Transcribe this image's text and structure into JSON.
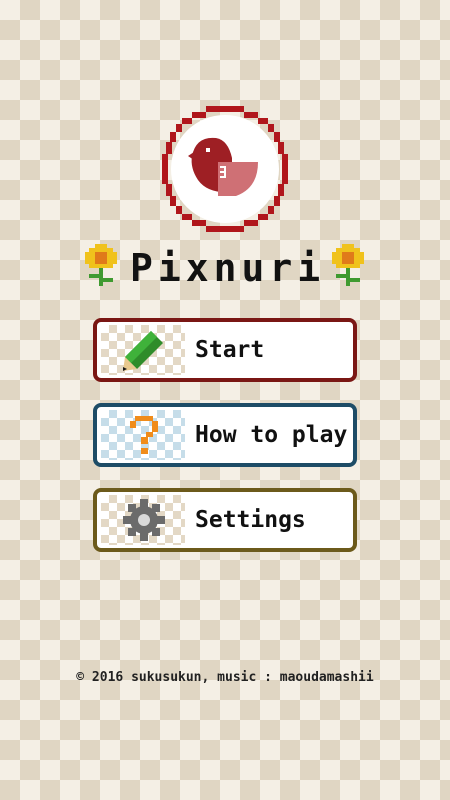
{
  "app": {
    "title": "Pixnuri"
  },
  "logo": {
    "icon": "bird-icon",
    "ring_color": "#b0161b",
    "bird_color": "#9e1f24"
  },
  "menu": {
    "items": [
      {
        "label": "Start",
        "icon": "pencil-icon",
        "border_color": "#7a1714"
      },
      {
        "label": "How to play",
        "icon": "question-mark-icon",
        "border_color": "#1d4c66"
      },
      {
        "label": "Settings",
        "icon": "gear-icon",
        "border_color": "#6c5a1b"
      }
    ]
  },
  "footer": {
    "copyright": "© 2016 sukusukun, music : maoudamashii"
  },
  "colors": {
    "background_light": "#f4efe5",
    "background_dark": "#e0d6c3"
  }
}
